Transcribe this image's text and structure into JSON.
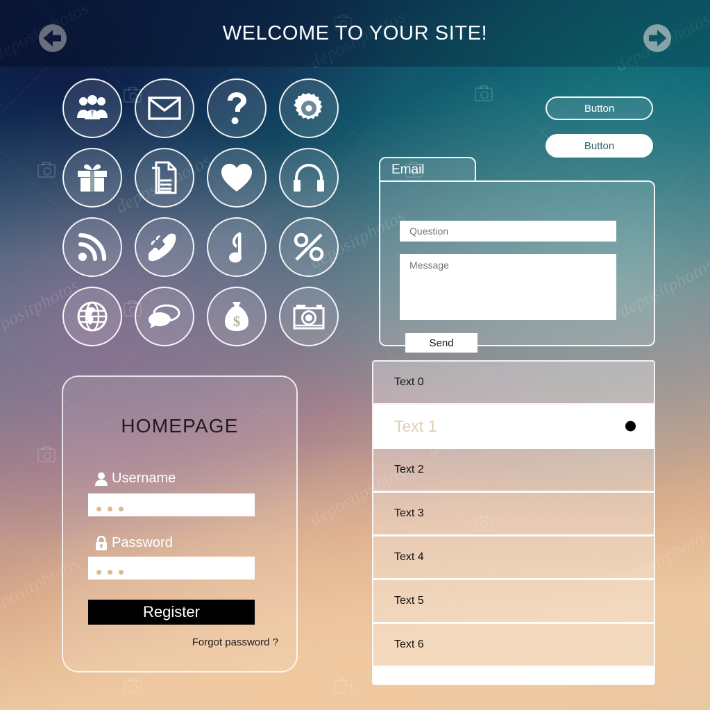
{
  "header": {
    "title": "WELCOME TO YOUR SITE!",
    "back_icon": "arrow-left-circle-icon",
    "forward_icon": "arrow-right-circle-icon"
  },
  "icon_grid": {
    "items": [
      {
        "name": "users-group-icon",
        "label": "Users"
      },
      {
        "name": "envelope-icon",
        "label": "Mail"
      },
      {
        "name": "question-mark-icon",
        "label": "Help"
      },
      {
        "name": "gear-icon",
        "label": "Settings"
      },
      {
        "name": "gift-icon",
        "label": "Gift"
      },
      {
        "name": "document-icon",
        "label": "Document"
      },
      {
        "name": "heart-icon",
        "label": "Favorites"
      },
      {
        "name": "headphones-icon",
        "label": "Audio"
      },
      {
        "name": "rss-feed-icon",
        "label": "Feed"
      },
      {
        "name": "phone-icon",
        "label": "Call"
      },
      {
        "name": "music-note-icon",
        "label": "Music"
      },
      {
        "name": "percent-icon",
        "label": "Discount"
      },
      {
        "name": "globe-icon",
        "label": "World"
      },
      {
        "name": "chat-bubbles-icon",
        "label": "Chat"
      },
      {
        "name": "money-bag-icon",
        "label": "Money"
      },
      {
        "name": "camera-icon",
        "label": "Photo"
      }
    ]
  },
  "buttons": {
    "outline_label": "Button",
    "solid_label": "Button"
  },
  "email_panel": {
    "tab_label": "Email",
    "question_placeholder": "Question",
    "question_value": "",
    "message_placeholder": "Message",
    "message_value": "",
    "send_label": "Send"
  },
  "login_panel": {
    "title": "HOMEPAGE",
    "username_label": "Username",
    "username_icon": "user-icon",
    "username_value": "• • •",
    "password_label": "Password",
    "password_icon": "lock-icon",
    "password_value": "• • •",
    "register_label": "Register",
    "forgot_label": "Forgot  password ?"
  },
  "list_panel": {
    "rows": [
      {
        "label": "Text 0",
        "selected": false
      },
      {
        "label": "Text 1",
        "selected": true
      },
      {
        "label": "Text 2",
        "selected": false
      },
      {
        "label": "Text 3",
        "selected": false
      },
      {
        "label": "Text 4",
        "selected": false
      },
      {
        "label": "Text 5",
        "selected": false
      },
      {
        "label": "Text 6",
        "selected": false
      }
    ],
    "marker_icon": "selected-dot-icon"
  },
  "watermark": {
    "text": "depositphotos",
    "camera_icon": "camera-watermark-icon"
  },
  "colors": {
    "header_overlay": "#0a1c38",
    "accent_teal": "#2e5f63",
    "register_bg": "#000000",
    "panel_white": "#ffffff",
    "input_dot": "#dcb996",
    "selected_row_text": "#e0cdb4"
  }
}
